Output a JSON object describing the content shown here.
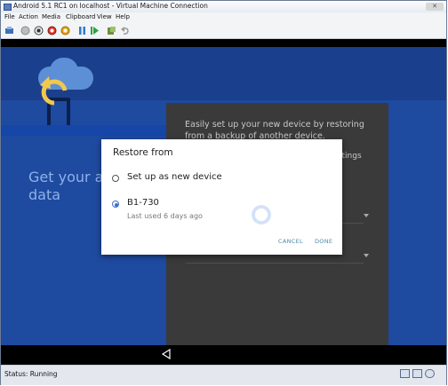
{
  "window": {
    "title": "Android 5.1 RC1 on localhost - Virtual Machine Connection",
    "close_label": "✕"
  },
  "menu": [
    "File",
    "Action",
    "Media",
    "Clipboard",
    "View",
    "Help"
  ],
  "toolbar": {
    "icons": [
      "ctrl-alt-del-icon",
      "start-icon",
      "turn-off-icon",
      "shut-down-icon",
      "save-icon",
      "pause-icon",
      "reset-icon",
      "snapshot-icon",
      "revert-icon"
    ]
  },
  "android": {
    "background_headline": "Get your ap\ndata",
    "card_text": "Easily set up your new device by restoring from a backup of another device.",
    "ghost_settings": "ttings",
    "colors": {
      "background": "#1e4aa0",
      "accent": "#3b6fd3",
      "button_text": "#4c8aa8"
    }
  },
  "dialog": {
    "title": "Restore from",
    "options": [
      {
        "label": "Set up as new device",
        "selected": false
      },
      {
        "label": "B1-730",
        "sublabel": "Last used 6 days ago",
        "selected": true
      }
    ],
    "cancel_label": "CANCEL",
    "done_label": "DONE"
  },
  "status": {
    "text": "Status: Running"
  }
}
